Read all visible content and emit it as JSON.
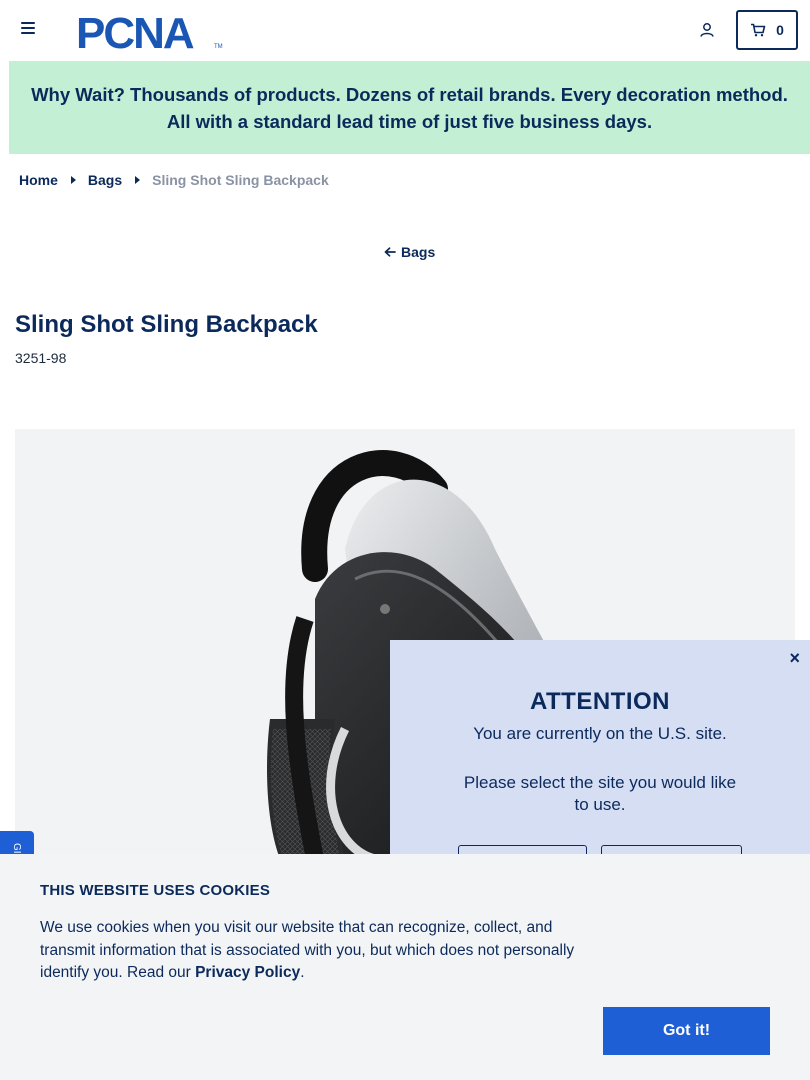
{
  "header": {
    "logo_text": "PCNA",
    "logo_tm": "TM",
    "cart_count": "0"
  },
  "promo": {
    "text": "Why Wait? Thousands of products. Dozens of retail brands. Every decoration method. All with a standard lead time of just five business days."
  },
  "breadcrumb": {
    "home": "Home",
    "category": "Bags",
    "current": "Sling Shot Sling Backpack"
  },
  "back_link": "Bags",
  "product": {
    "title": "Sling Shot Sling Backpack",
    "sku": "3251-98"
  },
  "feedback_tab": "GI",
  "attention": {
    "close": "×",
    "title": "ATTENTION",
    "line1": "You are currently on the U.S. site.",
    "line2": "Please select the site you would like to use."
  },
  "cookie": {
    "title": "THIS WEBSITE USES COOKIES",
    "text": "We use cookies when you visit our website that can recognize, collect, and transmit information that is associated with you, but which does not personally identify you. Read our ",
    "link": "Privacy Policy",
    "period": ".",
    "button": "Got it!"
  },
  "colors": {
    "navy": "#0b2a5b",
    "promo_bg": "#c3efd4",
    "accent_blue": "#1f5fd6",
    "modal_bg": "#d6def4"
  }
}
